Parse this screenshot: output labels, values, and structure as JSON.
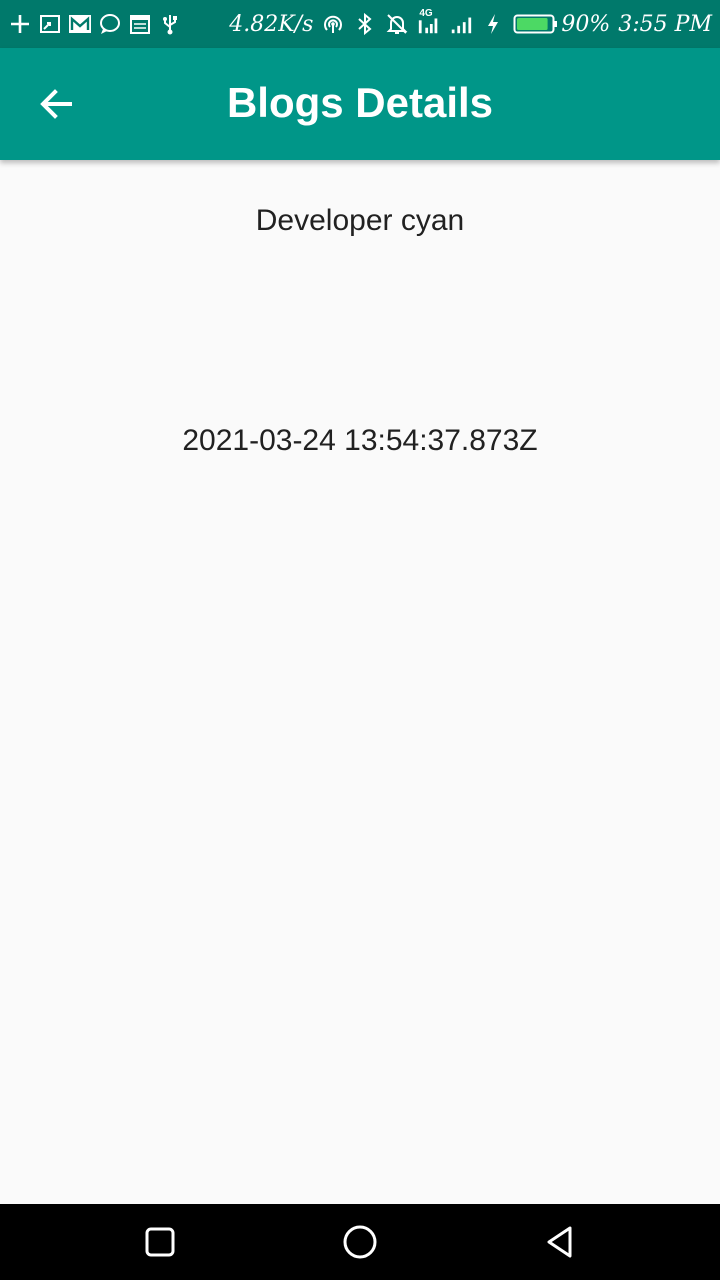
{
  "status_bar": {
    "network_speed": "4.82K/s",
    "network_type": "4G",
    "battery_level_percent": 90,
    "battery_text": "90%",
    "time": "3:55 PM",
    "left_icons": [
      "add-icon",
      "cast-icon",
      "gmail-icon",
      "message-icon",
      "calendar-icon",
      "usb-icon"
    ],
    "right_icons": [
      "hotspot-icon",
      "bluetooth-icon",
      "notifications-off-icon",
      "signal-4g-icon",
      "signal-icon",
      "charging-icon",
      "battery-icon"
    ],
    "colors": {
      "background": "#00796b",
      "battery_fill": "#4cd964"
    }
  },
  "app_bar": {
    "title": "Blogs Details",
    "back_icon": "arrow-back-icon",
    "colors": {
      "background": "#009688",
      "text": "#ffffff"
    }
  },
  "content": {
    "author": "Developer cyan",
    "timestamp": "2021-03-24 13:54:37.873Z"
  },
  "nav_bar": {
    "buttons": [
      "recents-square-icon",
      "home-circle-icon",
      "back-triangle-icon"
    ]
  }
}
